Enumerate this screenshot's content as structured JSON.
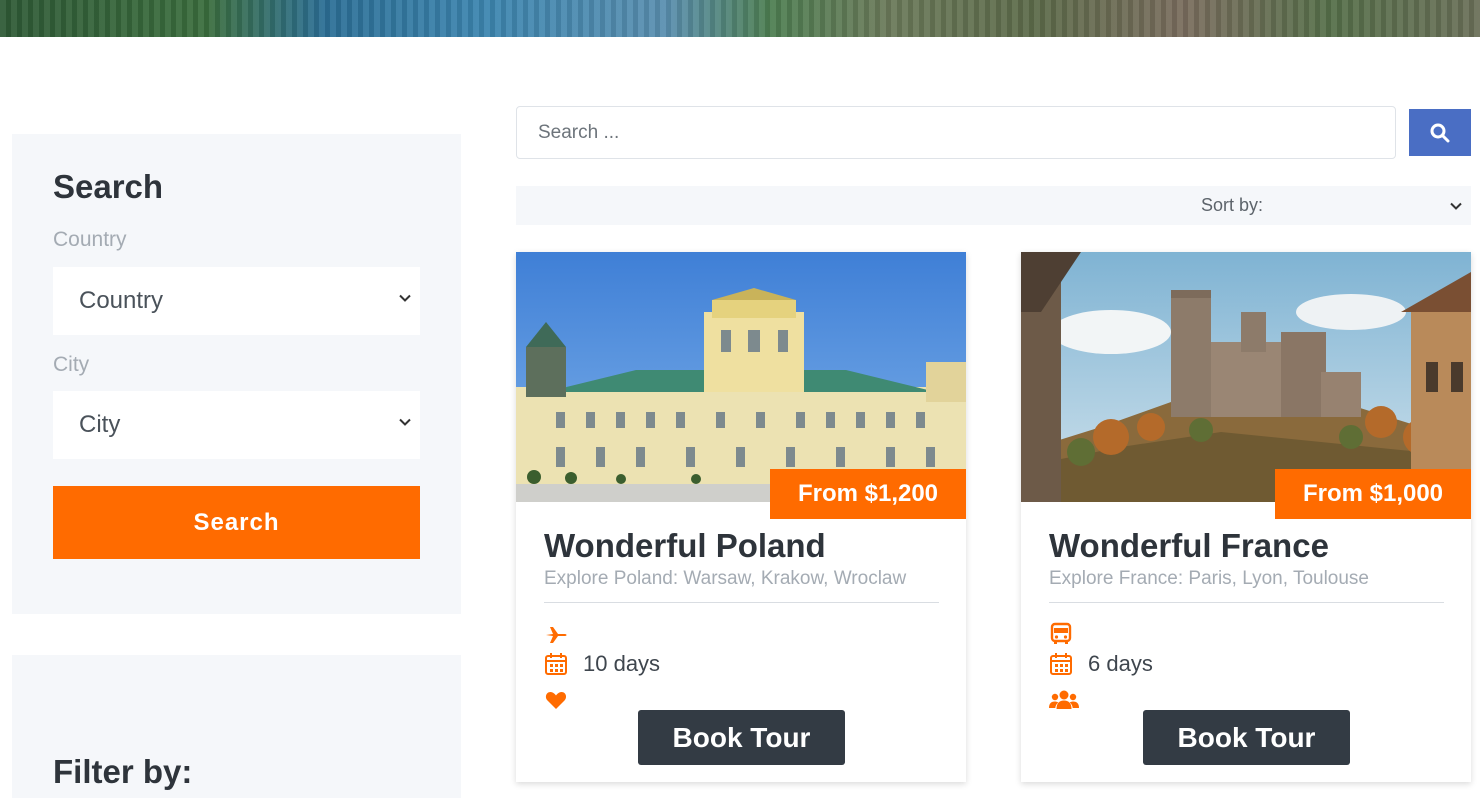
{
  "sidebar": {
    "search_title": "Search",
    "country_label": "Country",
    "country_value": "Country",
    "city_label": "City",
    "city_value": "City",
    "search_button": "Search",
    "filter_title": "Filter by:"
  },
  "top_search": {
    "placeholder": "Search ...",
    "button_icon": "search-icon"
  },
  "sort": {
    "label": "Sort by:"
  },
  "tours": [
    {
      "price": "From $1,200",
      "title": "Wonderful Poland",
      "subtitle": "Explore Poland: Warsaw, Krakow, Wroclaw",
      "transport_icon": "plane-icon",
      "duration": "10 days",
      "extra_icon": "heart-icon",
      "button": "Book Tour"
    },
    {
      "price": "From $1,000",
      "title": "Wonderful France",
      "subtitle": "Explore France: Paris, Lyon, Toulouse",
      "transport_icon": "bus-icon",
      "duration": "6 days",
      "extra_icon": "users-icon",
      "button": "Book Tour"
    }
  ],
  "colors": {
    "accent": "#ff6b00",
    "primary_button": "#4a6ec4",
    "dark_button": "#333b44",
    "panel_bg": "#f5f7fa"
  }
}
